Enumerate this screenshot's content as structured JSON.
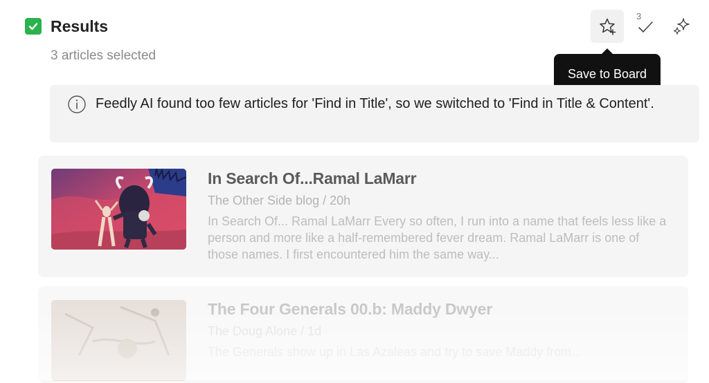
{
  "header": {
    "title": "Results",
    "checked": true,
    "selected_text": "3 articles selected"
  },
  "toolbar": {
    "save_icon": "star-plus-icon",
    "mark_read_icon": "check-icon",
    "mark_read_count": "3",
    "ai_icon": "sparkles-icon",
    "tooltip": "Save to Board"
  },
  "notice": {
    "icon": "info-icon",
    "text": "Feedly AI found too few articles for 'Find in Title', so we switched to 'Find in Title & Content'."
  },
  "articles": [
    {
      "title": "In Search Of...Ramal LaMarr",
      "meta": "The Other Side blog / 20h",
      "snippet": "In Search Of... Ramal LaMarr Every so often, I run into a name that feels less like a person and more like a half-remembered fever dream. Ramal LaMarr is one of those names. I first encountered him the same way..."
    },
    {
      "title": "The Four Generals 00.b: Maddy Dwyer",
      "meta": "The Doug Alone / 1d",
      "snippet": "The Generals show up in Las Azaleas and try to save Maddy from..."
    }
  ],
  "colors": {
    "check_green": "#2bb24c",
    "tooltip_bg": "#111111",
    "notice_bg": "#f3f3f3"
  }
}
